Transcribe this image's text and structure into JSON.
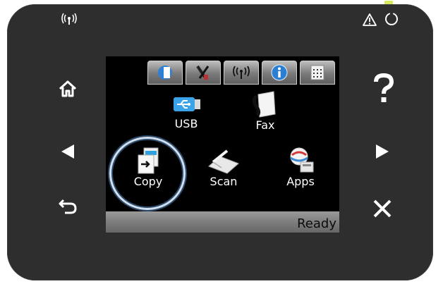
{
  "panel": {
    "top_left_indicator": "wireless-icon",
    "top_right_indicators": [
      "attention-icon",
      "power-icon"
    ],
    "left_buttons": [
      "home-icon",
      "back-arrow-icon",
      "return-icon"
    ],
    "right_buttons": [
      "help-icon",
      "forward-arrow-icon",
      "cancel-icon"
    ]
  },
  "screen": {
    "top_buttons": [
      "supplies-icon",
      "setup-icon",
      "wireless-icon",
      "info-icon",
      "web-services-icon"
    ],
    "apps": [
      {
        "label": "USB",
        "icon": "usb-icon"
      },
      {
        "label": "Fax",
        "icon": "fax-icon"
      },
      {
        "label": "Copy",
        "icon": "copy-icon",
        "selected": true
      },
      {
        "label": "Scan",
        "icon": "scan-icon"
      },
      {
        "label": "Apps",
        "icon": "apps-icon"
      }
    ],
    "status": "Ready"
  },
  "colors": {
    "panel": "#2e2e2e",
    "screen": "#000000",
    "selection_ring": "#cfe0f0",
    "power_led": "#d7e85a"
  }
}
